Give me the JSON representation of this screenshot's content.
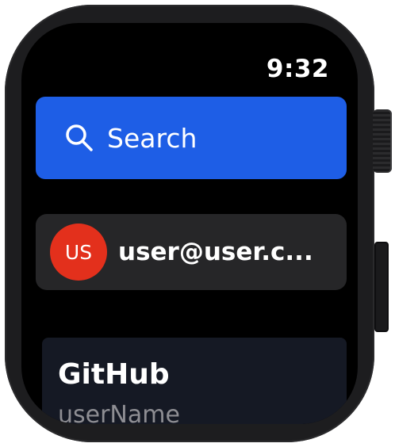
{
  "status_bar": {
    "time": "9:32"
  },
  "search": {
    "label": "Search",
    "icon": "search-icon"
  },
  "account": {
    "initials": "US",
    "email": "user@user.c..."
  },
  "card": {
    "title": "GitHub",
    "subtitle": "userName"
  },
  "colors": {
    "accent": "#1e5ee6",
    "avatar": "#e3301c",
    "row_background": "#262628",
    "card_background": "#151924",
    "screen_background": "#000000"
  }
}
